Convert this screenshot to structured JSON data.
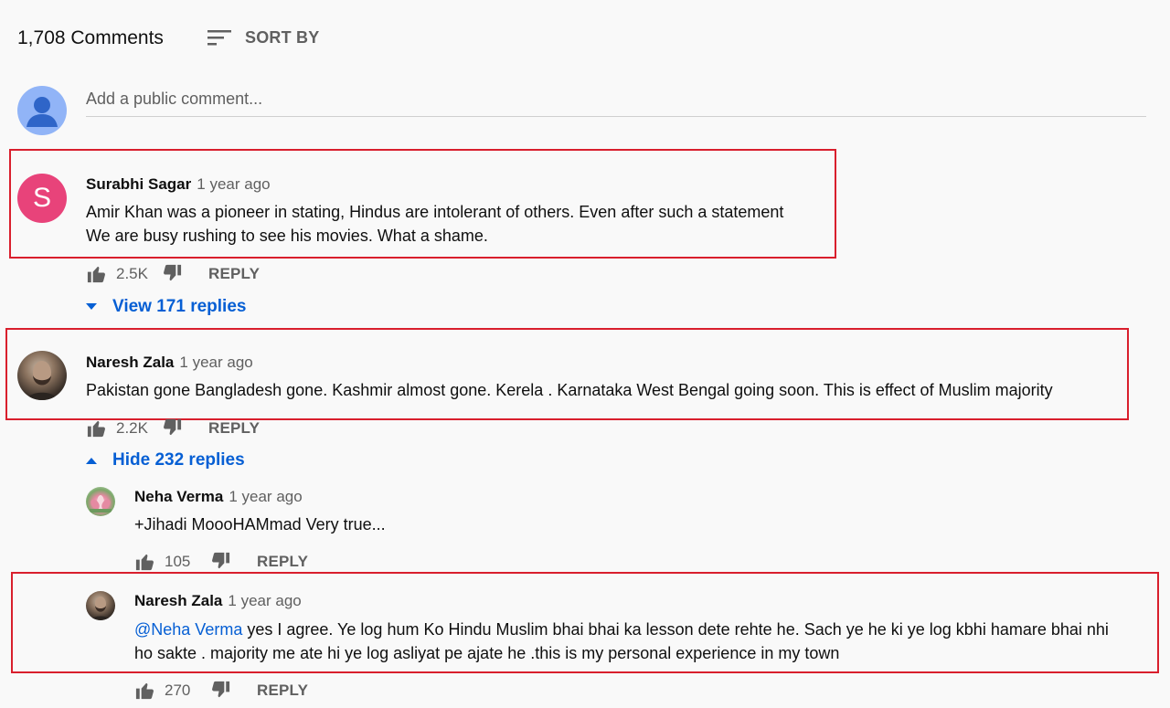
{
  "header": {
    "comment_count": "1,708 Comments",
    "sort_label": "SORT BY",
    "sort_icon": "sort-icon"
  },
  "add_comment": {
    "placeholder": "Add a public comment...",
    "avatar_icon": "user-avatar-icon"
  },
  "comments": [
    {
      "author": "Surabhi Sagar",
      "avatar_letter": "S",
      "time": "1 year ago",
      "lines": [
        "Amir Khan was a pioneer in stating, Hindus are intolerant of others.  Even after such a statement",
        "We are busy rushing to see his movies.  What a shame."
      ],
      "likes": "2.5K",
      "reply_label": "REPLY",
      "toggle_label": "View 171 replies"
    },
    {
      "author": "Naresh Zala",
      "time": "1 year ago",
      "lines": [
        "Pakistan gone Bangladesh gone.  Kashmir almost gone.  Kerela . Karnataka  West Bengal going soon.  This is effect of Muslim majority"
      ],
      "likes": "2.2K",
      "reply_label": "REPLY",
      "toggle_label": "Hide 232 replies",
      "replies": [
        {
          "author": "Neha Verma",
          "time": "1 year ago",
          "text": "+Jihadi MoooHAMmad Very true...",
          "likes": "105",
          "reply_label": "REPLY"
        },
        {
          "author": "Naresh Zala",
          "time": "1 year ago",
          "mention": "@Neha Verma",
          "line1": " yes I agree.  Ye log hum Ko Hindu Muslim bhai bhai ka lesson dete rehte he.  Sach ye he ki ye log kbhi hamare bhai nhi",
          "line2": "ho sakte . majority me ate hi ye log asliyat pe ajate he .this is my personal experience in my town",
          "likes": "270",
          "reply_label": "REPLY"
        }
      ]
    }
  ],
  "colors": {
    "highlight_border": "#d91f2d",
    "link": "#065fd4",
    "secondary_text": "#606060"
  }
}
